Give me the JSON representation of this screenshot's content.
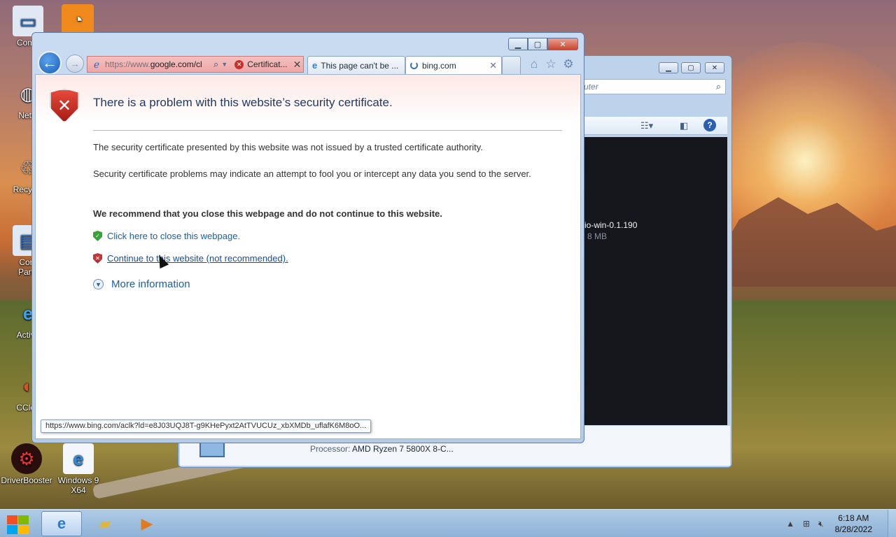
{
  "desktop": {
    "icons": [
      {
        "label": "Comp",
        "glyph": "computer-icon"
      },
      {
        "label": "Netw",
        "glyph": "network-icon"
      },
      {
        "label": "Recycle",
        "glyph": "recycle-bin-icon"
      },
      {
        "label": "Cont\nPane",
        "glyph": "control-panel-icon"
      },
      {
        "label": "Activa",
        "glyph": "internet-explorer-icon"
      },
      {
        "label": "CClea",
        "glyph": "ccleaner-icon"
      },
      {
        "label": "DriverBooster",
        "glyph": "driverbooster-icon"
      },
      {
        "label": "Windows 9\nX64",
        "glyph": "internet-explorer-icon"
      }
    ]
  },
  "background_window": {
    "search_placeholder": "Computer",
    "file_name": "io-win-0.1.190",
    "file_size": "8 MB",
    "processor_label": "Processor:",
    "processor_value": "AMD Ryzen 7 5800X 8-C..."
  },
  "ie": {
    "address_url_gray": "https://www.",
    "address_url_black": "google.com/cl",
    "cert_label": "Certificat...",
    "tabs": [
      {
        "label": "This page can't be ..."
      },
      {
        "label": "bing.com"
      }
    ],
    "page": {
      "heading": "There is a problem with this website’s security certificate.",
      "p1": "The security certificate presented by this website was not issued by a trusted certificate authority.",
      "p2": "Security certificate problems may indicate an attempt to fool you or intercept any data you send to the server.",
      "recommend": "We recommend that you close this webpage and do not continue to this website.",
      "close_link": "Click here to close this webpage.",
      "continue_link": "Continue to this website (not recommended).",
      "more_info": "More information"
    },
    "status_url": "https://www.bing.com/aclk?ld=e8J03UQJ8T-g9KHePyxt2AtTVUCUz_xbXMDb_uflafK6M8oO..."
  },
  "taskbar": {
    "time": "6:18 AM",
    "date": "8/28/2022"
  },
  "colors": {
    "link": "#1a5fa8",
    "heading": "#1e3b66",
    "error_red": "#c9302c",
    "ok_green": "#3aa23a"
  }
}
